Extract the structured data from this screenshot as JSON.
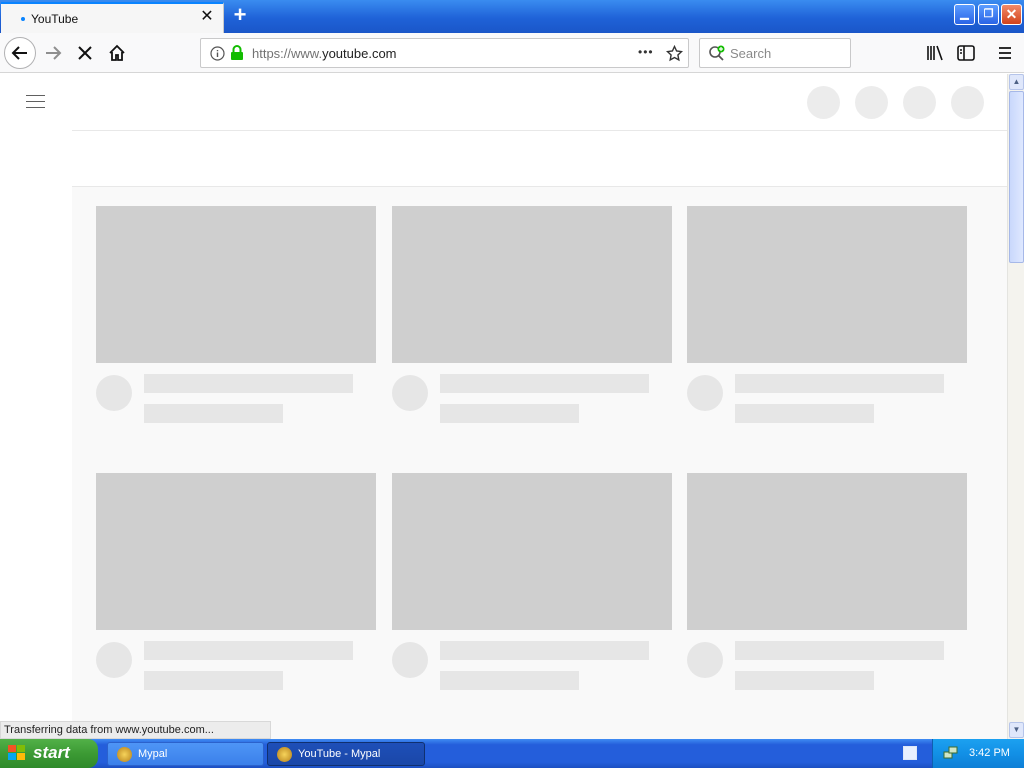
{
  "browser": {
    "tab_title": "YouTube",
    "new_tab_label": "+",
    "url_prefix": "https://www.",
    "url_domain": "youtube.com",
    "search_placeholder": "Search",
    "page_actions_label": "•••"
  },
  "page": {
    "status_text": "Transferring data from www.youtube.com..."
  },
  "taskbar": {
    "start_label": "start",
    "items": [
      {
        "label": "Mypal"
      },
      {
        "label": "YouTube - Mypal"
      }
    ],
    "clock": "3:42 PM"
  },
  "colors": {
    "tab_accent": "#0a84ff",
    "lock_green": "#12bc00",
    "placeholder_grey": "#cfcfcf",
    "taskbar_blue": "#245edb",
    "start_green": "#3c9a34"
  }
}
